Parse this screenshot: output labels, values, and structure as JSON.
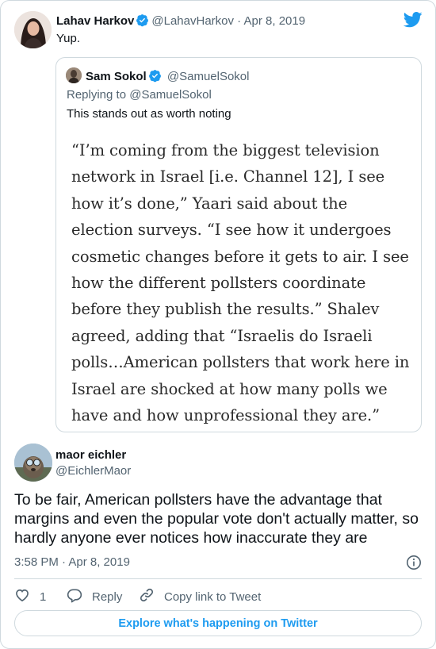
{
  "parent_tweet": {
    "author_name": "Lahav Harkov",
    "handle_date": "@LahavHarkov · Apr 8, 2019",
    "text": "Yup."
  },
  "quoted_tweet": {
    "author_name": "Sam Sokol",
    "handle": "@SamuelSokol",
    "replying_to": "Replying to @SamuelSokol",
    "text": "This stands out as worth noting",
    "image_text": "“I’m coming from the biggest television network in Israel [i.e. Channel 12], I see how it’s done,” Yaari said about the election surveys. “I see how it undergoes cosmetic changes before it gets to air. I see how the different pollsters coordinate before they publish the results.” Shalev agreed, adding that “Israelis do Israeli polls…American pollsters that work here in Israel are shocked at how many polls we have and how unprofessional they are.”"
  },
  "main_tweet": {
    "author_name": "maor eichler",
    "handle": "@EichlerMaor",
    "text": "To be fair, American pollsters have the advantage that margins and even the popular vote don't actually matter, so hardly anyone ever notices how inaccurate they are",
    "timestamp": "3:58 PM · Apr 8, 2019"
  },
  "actions": {
    "like_count": "1",
    "reply_label": "Reply",
    "copy_link_label": "Copy link to Tweet"
  },
  "explore_button": "Explore what's happening on Twitter",
  "icons": {
    "brand": "twitter-bird-icon",
    "verified": "verified-badge-icon",
    "info": "info-icon",
    "like": "heart-icon",
    "reply": "reply-bubble-icon",
    "link": "link-icon"
  },
  "colors": {
    "accent": "#1d9bf0",
    "text": "#0f1419",
    "muted": "#536471",
    "border": "#cfd9de"
  }
}
